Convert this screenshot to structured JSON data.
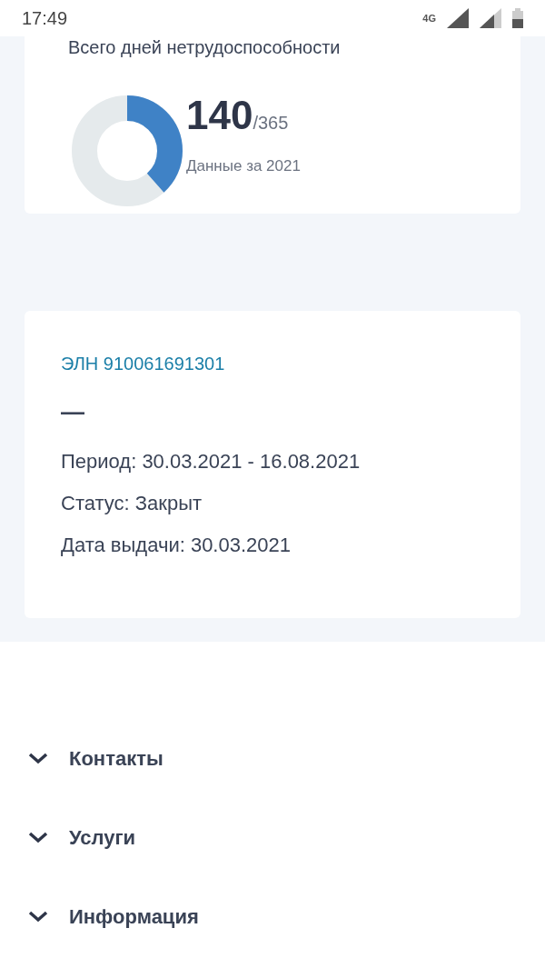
{
  "status_bar": {
    "time": "17:49",
    "network": "4G"
  },
  "summary_card": {
    "title": "Всего дней нетрудоспособности",
    "days": "140",
    "total": "/365",
    "level": 0.384,
    "caption": "Данные за 2021"
  },
  "certificate_card": {
    "number": "ЭЛН 910061691301",
    "dash": "—",
    "details": [
      "Период: 30.03.2021 - 16.08.2021",
      "Статус: Закрыт",
      "Дата выдачи: 30.03.2021"
    ]
  },
  "footer_menu": [
    {
      "label": "Контакты",
      "expanded": false
    },
    {
      "label": "Услуги",
      "expanded": false
    },
    {
      "label": "Информация",
      "expanded": false
    }
  ]
}
